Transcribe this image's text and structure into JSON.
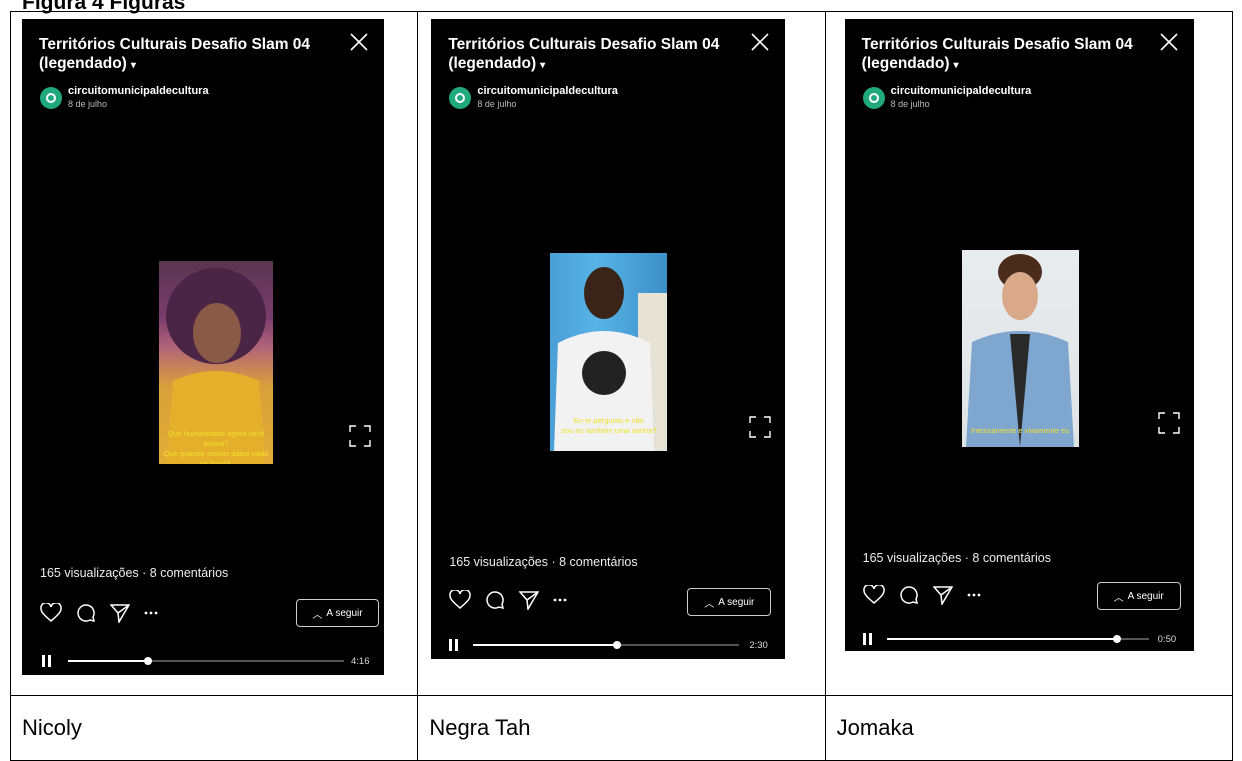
{
  "heading": "Figura 4 Figuras",
  "video_title": "Territórios Culturais  Desafio Slam 04 (legendado)",
  "account": "circuitomunicipaldecultura",
  "date": "8 de julho",
  "stats": "165 visualizações · 8 comentários",
  "follow_label": "A seguir",
  "cells": [
    {
      "name": "Nicoly",
      "time": "4:16",
      "progress": 0.29,
      "subtitle_lines": [
        "Que humanidade agora você levará?",
        "Que quando morrer daqui nada se levará."
      ]
    },
    {
      "name": "Negra Tah",
      "time": "2:30",
      "progress": 0.54,
      "subtitle_lines": [
        "Eu te pergunto e não",
        "sou eu também uma rainha?"
      ]
    },
    {
      "name": "Jomaka",
      "time": "0:50",
      "progress": 0.88,
      "subtitle_lines": [
        "Intensamente e vivamente eu"
      ]
    }
  ]
}
